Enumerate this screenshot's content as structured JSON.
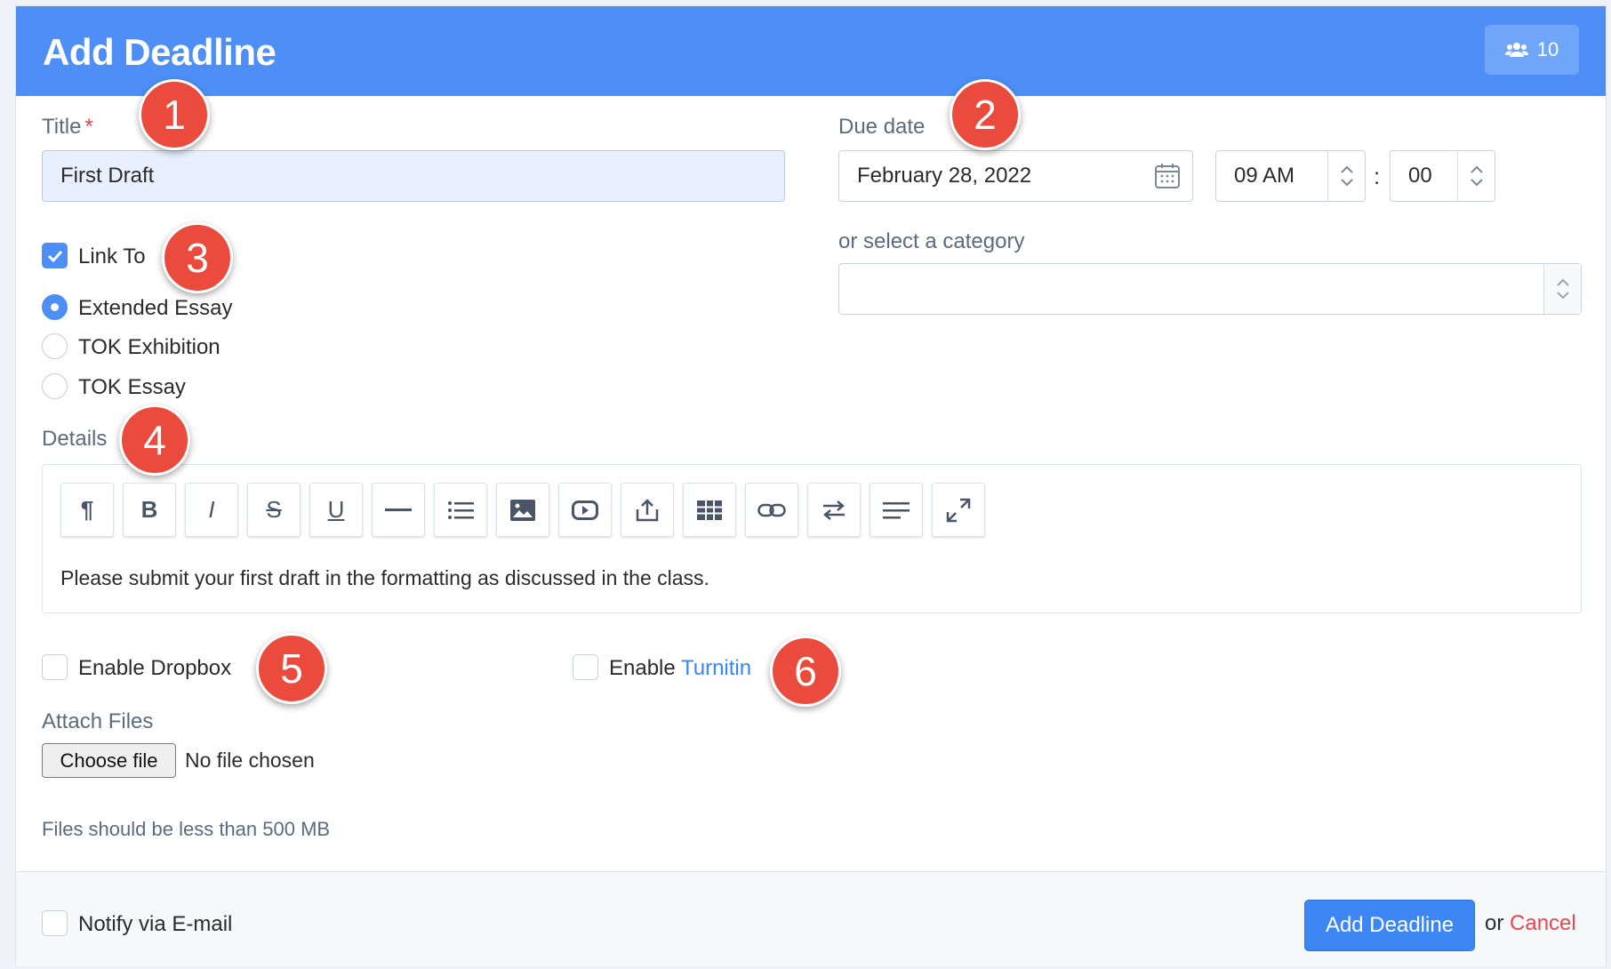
{
  "header": {
    "title": "Add Deadline",
    "members_count": "10"
  },
  "form": {
    "title_label": "Title",
    "title_required_mark": "*",
    "title_value": "First Draft",
    "due_date_label": "Due date",
    "due_date_value": "February 28, 2022",
    "hour_value": "09 AM",
    "minute_value": "00",
    "time_separator": ":",
    "category_label": "or select a category",
    "category_value": "",
    "link_to_label": "Link To",
    "link_to_checked": true,
    "link_options": [
      {
        "label": "Extended Essay",
        "selected": true
      },
      {
        "label": "TOK Exhibition",
        "selected": false
      },
      {
        "label": "TOK Essay",
        "selected": false
      }
    ],
    "details_label": "Details",
    "details_text": "Please submit your first draft in the formatting as discussed in the class.",
    "enable_dropbox_label": "Enable Dropbox",
    "enable_label": "Enable",
    "turnitin_link": "Turnitin",
    "attach_files_label": "Attach Files",
    "choose_file_label": "Choose file",
    "no_file_text": "No file chosen",
    "file_size_note": "Files should be less than 500 MB"
  },
  "toolbar": {
    "buttons": [
      "paragraph-icon",
      "bold-icon",
      "italic-icon",
      "strikethrough-icon",
      "underline-icon",
      "horizontal-rule-icon",
      "list-icon",
      "image-icon",
      "video-icon",
      "upload-icon",
      "table-icon",
      "link-icon",
      "direction-icon",
      "align-icon",
      "fullscreen-icon"
    ],
    "paragraph": "¶",
    "bold": "B",
    "italic": "I",
    "strike": "S",
    "underline": "U"
  },
  "footer": {
    "notify_label": "Notify via E-mail",
    "submit_label": "Add Deadline",
    "or_text": "or",
    "cancel_label": "Cancel"
  },
  "annotations": [
    "1",
    "2",
    "3",
    "4",
    "5",
    "6"
  ],
  "colors": {
    "header": "#4d8ff7",
    "accent": "#3d87f5",
    "badge": "#ea4b3c",
    "cancel": "#e5484d"
  }
}
